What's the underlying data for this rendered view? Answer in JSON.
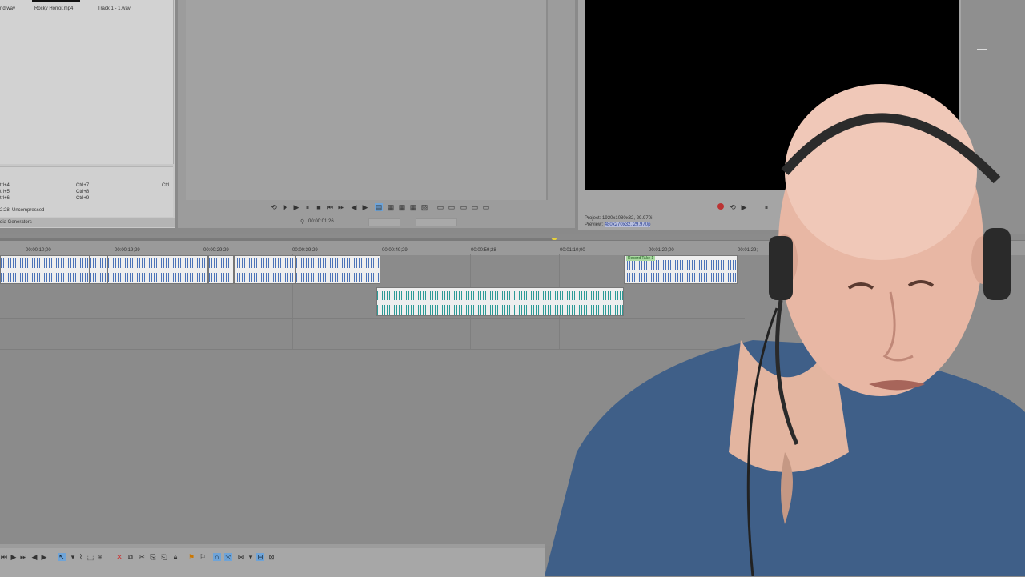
{
  "explorer": {
    "files": [
      "nd.wav",
      "Rocky Horror.mp4",
      "Track 1 - 1.wav"
    ],
    "shortcuts_left": [
      "trl+4",
      "trl+5",
      "trl+6"
    ],
    "shortcuts_mid": [
      "Ctrl+7",
      "Ctrl+8",
      "Ctrl+9"
    ],
    "shortcut_right": "Ctrl",
    "format_info": "2:28, Uncompressed",
    "tab_label": "dia Generators"
  },
  "trimmer": {
    "timecode": "00:00:01;26"
  },
  "preview": {
    "project_label": "Project:",
    "project_value": "1920x1080x32, 29.970i",
    "preview_label": "Preview:",
    "preview_value": "480x270x32, 29.970p"
  },
  "ruler": {
    "ticks": [
      "00:00:10;00",
      "00:00:19;29",
      "00:00:29;29",
      "00:00:39;29",
      "00:00:49;29",
      "00:00:59;28",
      "00:01:10;00",
      "00:01:20;00",
      "00:01:29;"
    ]
  },
  "timeline": {
    "record_label": "Record Take 1"
  },
  "colors": {
    "wave_blue": "#4b73b8",
    "wave_teal": "#2c9a96",
    "selected_tool": "#6fa4d8"
  },
  "icons": [
    "play-icon",
    "pause-icon",
    "stop-icon",
    "record-icon",
    "loop-icon",
    "snap-icon",
    "marker-icon"
  ]
}
